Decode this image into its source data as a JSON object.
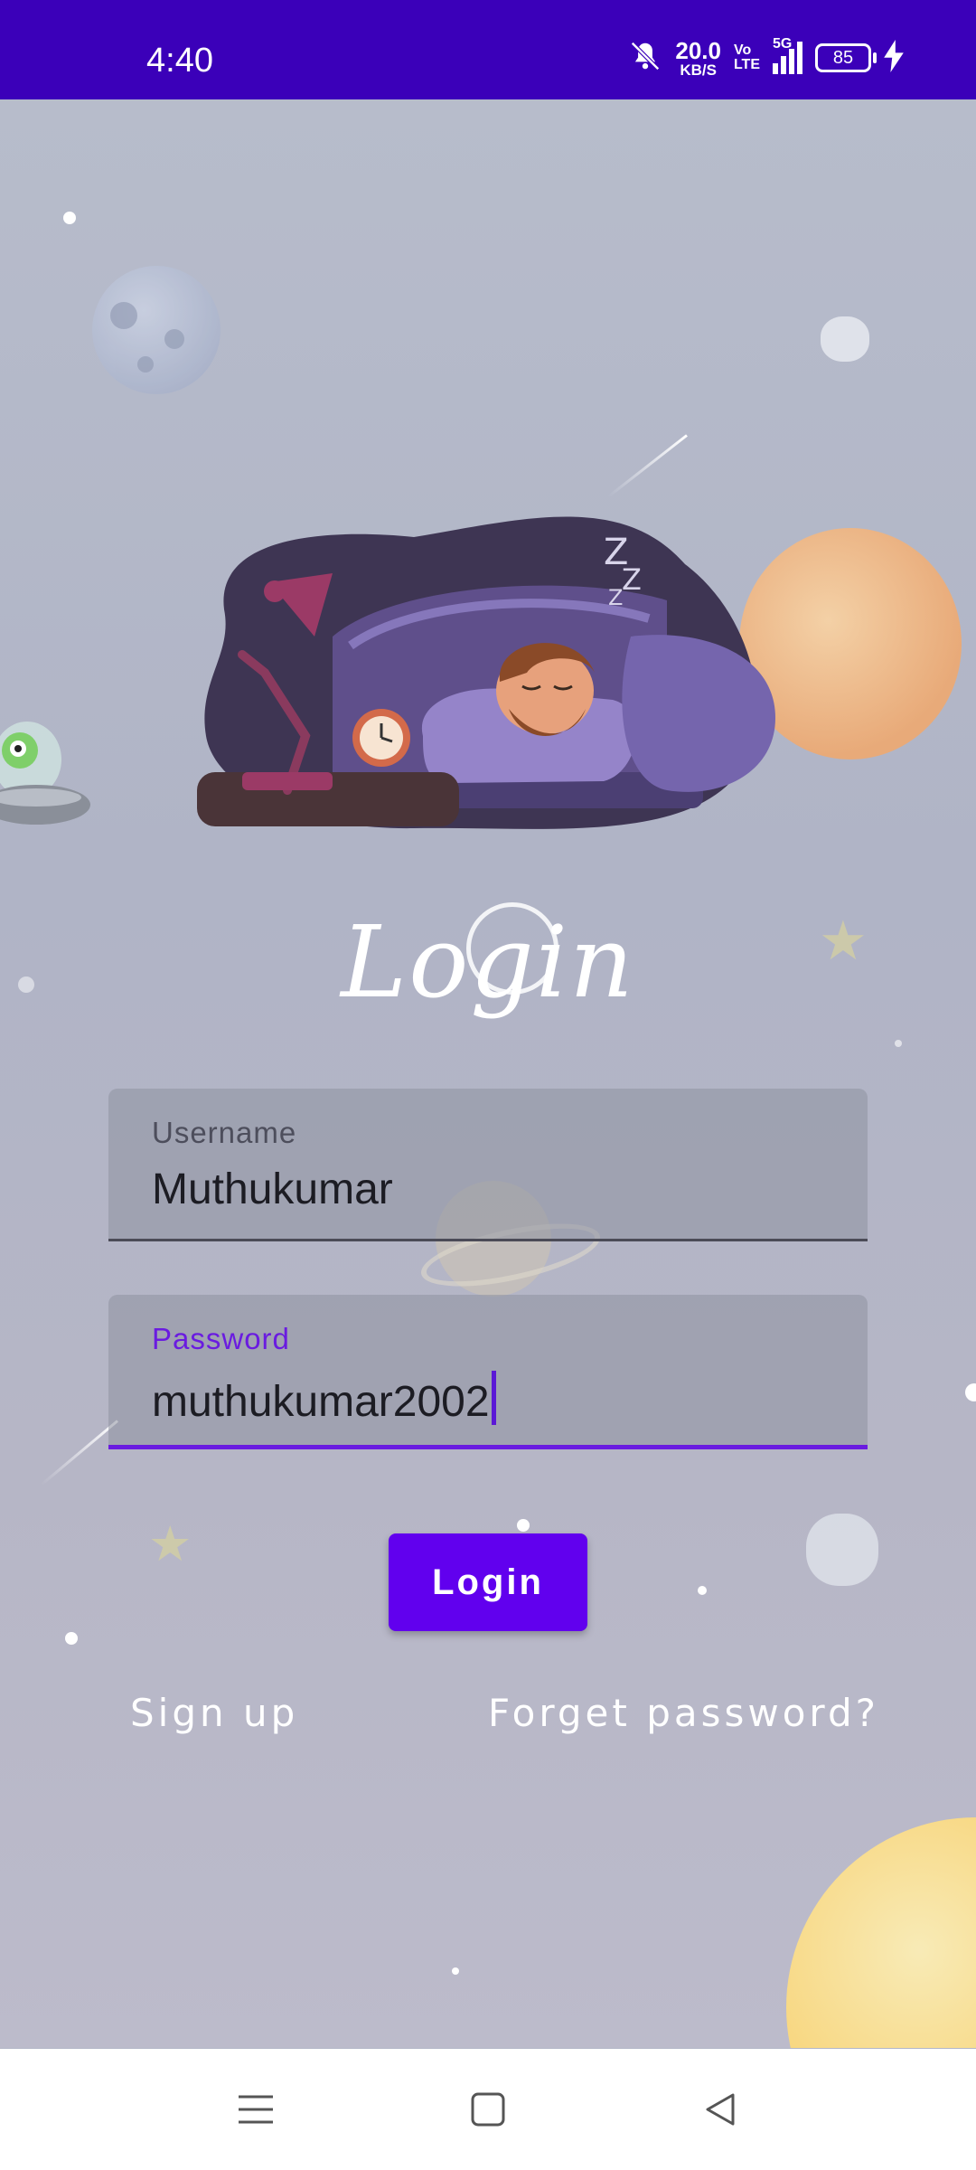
{
  "status_bar": {
    "time": "4:40",
    "net_speed_value": "20.0",
    "net_speed_unit": "KB/S",
    "volte_top": "Vo",
    "volte_bottom": "LTE",
    "signal_label": "5G",
    "battery_level": "85",
    "icons": [
      "mute-bell-icon",
      "signal-icon",
      "battery-icon",
      "charging-icon"
    ]
  },
  "page": {
    "title": "Login"
  },
  "form": {
    "username_label": "Username",
    "username_value": "Muthukumar",
    "password_label": "Password",
    "password_value": "muthukumar2002",
    "login_button": "Login",
    "signup_link": "Sign up",
    "forgot_link": "Forget password?"
  },
  "colors": {
    "status_bar": "#3b00b9",
    "accent": "#6100ee",
    "background": "#b3b7c8"
  },
  "nav_bar": {
    "icons": [
      "menu-icon",
      "home-square-icon",
      "back-triangle-icon"
    ]
  }
}
